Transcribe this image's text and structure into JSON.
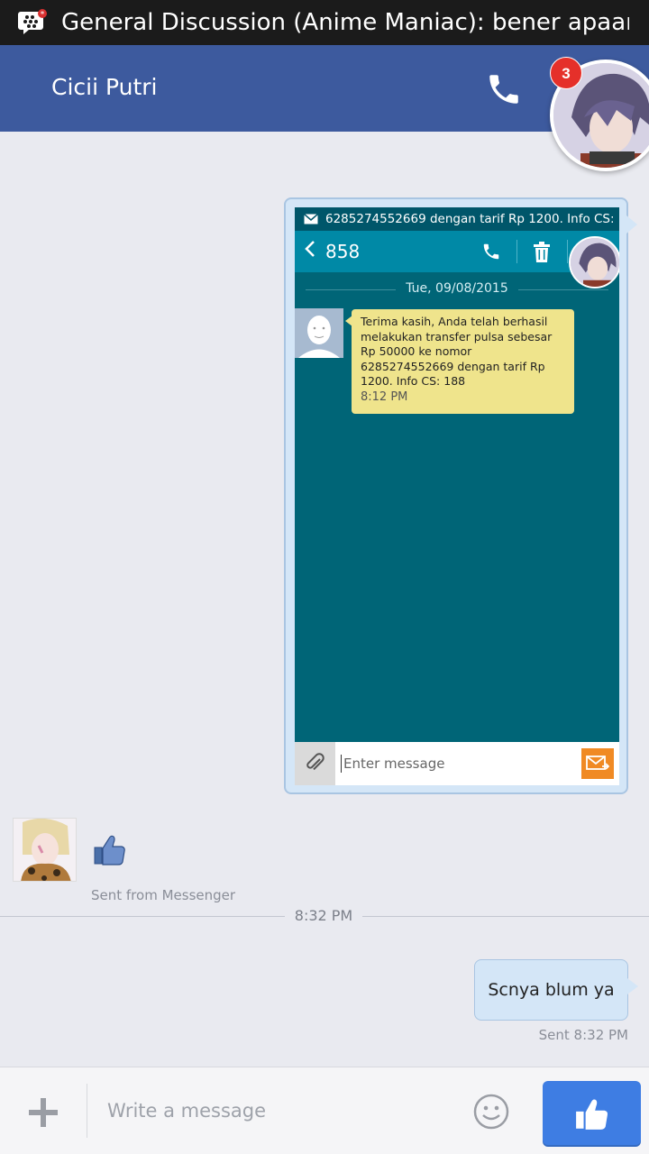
{
  "status_bar": {
    "notification_title": "General Discussion (Anime Maniac): bener apaan",
    "app_icon": "bbm-icon"
  },
  "header": {
    "contact_name": "Cicii Putri",
    "call_icon": "phone-icon",
    "chathead_badge": "3"
  },
  "image_message": {
    "notification_text": "6285274552669 dengan tarif Rp 1200. Info CS:",
    "thread_number": "858",
    "date": "Tue, 09/08/2015",
    "sms_text": "Terima kasih, Anda telah berhasil melakukan transfer pulsa sebesar Rp 50000 ke nomor 6285274552669 dengan tarif Rp 1200. Info CS: 188",
    "sms_time": "8:12 PM",
    "input_placeholder": "Enter message"
  },
  "incoming": {
    "like_icon": "thumbs-up-icon",
    "caption": "Sent from Messenger"
  },
  "time_separator": "8:32 PM",
  "outgoing": {
    "text": "Scnya blum ya",
    "status": "Sent 8:32 PM"
  },
  "composer": {
    "placeholder": "Write a message",
    "add_icon": "plus-icon",
    "emoji_icon": "smiley-icon",
    "send_like_icon": "thumbs-up-icon"
  },
  "colors": {
    "header": "#3d5a9e",
    "bubble": "#d4e6f7",
    "sms_bg": "#006577",
    "like_button": "#3e7de3",
    "badge": "#e5302a"
  }
}
